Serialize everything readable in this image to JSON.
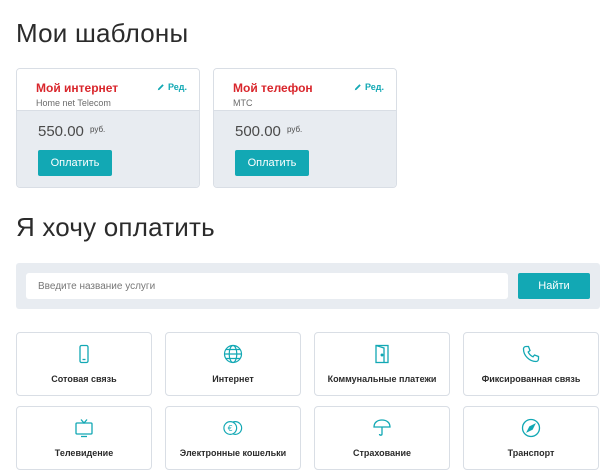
{
  "templates_section": {
    "title": "Мои шаблоны",
    "edit_label": "Ред.",
    "items": [
      {
        "name": "Мой интернет",
        "provider": "Home net Telecom",
        "amount": "550.00",
        "currency": "руб.",
        "pay_label": "Оплатить"
      },
      {
        "name": "Мой телефон",
        "provider": "МТС",
        "amount": "500.00",
        "currency": "руб.",
        "pay_label": "Оплатить"
      }
    ]
  },
  "pay_section": {
    "title": "Я хочу оплатить",
    "search_placeholder": "Введите название услуги",
    "search_button": "Найти"
  },
  "categories": [
    {
      "label": "Сотовая связь",
      "icon": "mobile-phone-icon"
    },
    {
      "label": "Интернет",
      "icon": "globe-icon"
    },
    {
      "label": "Коммунальные платежи",
      "icon": "door-icon"
    },
    {
      "label": "Фиксированная связь",
      "icon": "landline-phone-icon"
    },
    {
      "label": "Телевидение",
      "icon": "tv-icon"
    },
    {
      "label": "Электронные кошельки",
      "icon": "coins-icon"
    },
    {
      "label": "Страхование",
      "icon": "umbrella-icon"
    },
    {
      "label": "Транспорт",
      "icon": "compass-icon"
    }
  ],
  "colors": {
    "accent": "#12a8b4",
    "template_name": "#d9262c",
    "panel_bg": "#e8ecf1",
    "border": "#d9dee5"
  }
}
